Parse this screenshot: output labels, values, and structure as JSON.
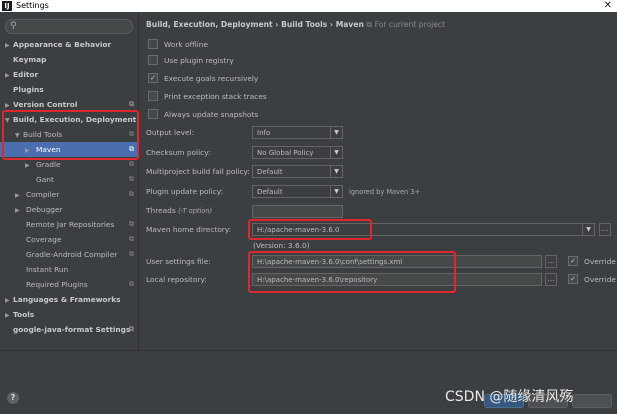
{
  "window": {
    "title": "Settings",
    "app_icon": "IJ",
    "close_glyph": "✕"
  },
  "sidebar": {
    "search_placeholder": "",
    "items": [
      {
        "label": "Appearance & Behavior",
        "bold": true,
        "arrow": "▶"
      },
      {
        "label": "Keymap",
        "bold": true,
        "arrow": ""
      },
      {
        "label": "Editor",
        "bold": true,
        "arrow": "▶"
      },
      {
        "label": "Plugins",
        "bold": true,
        "arrow": ""
      },
      {
        "label": "Version Control",
        "bold": true,
        "arrow": "▶"
      },
      {
        "label": "Build, Execution, Deployment",
        "bold": true,
        "arrow": "▼"
      },
      {
        "label": "Build Tools",
        "bold": false,
        "arrow": "▼"
      },
      {
        "label": "Maven",
        "bold": false,
        "arrow": "▶"
      },
      {
        "label": "Gradle",
        "bold": false,
        "arrow": "▶"
      },
      {
        "label": "Gant",
        "bold": false,
        "arrow": ""
      },
      {
        "label": "Compiler",
        "bold": false,
        "arrow": "▶"
      },
      {
        "label": "Debugger",
        "bold": false,
        "arrow": "▶"
      },
      {
        "label": "Remote Jar Repositories",
        "bold": false,
        "arrow": ""
      },
      {
        "label": "Coverage",
        "bold": false,
        "arrow": ""
      },
      {
        "label": "Gradle-Android Compiler",
        "bold": false,
        "arrow": ""
      },
      {
        "label": "Instant Run",
        "bold": false,
        "arrow": ""
      },
      {
        "label": "Required Plugins",
        "bold": false,
        "arrow": ""
      },
      {
        "label": "Languages & Frameworks",
        "bold": true,
        "arrow": "▶"
      },
      {
        "label": "Tools",
        "bold": true,
        "arrow": "▶"
      },
      {
        "label": "google-java-format Settings",
        "bold": true,
        "arrow": ""
      }
    ],
    "config_glyph": "⧉"
  },
  "breadcrumb": {
    "path": "Build, Execution, Deployment › Build Tools › Maven",
    "scope_icon": "⧉",
    "scope": "For current project"
  },
  "checkboxes": [
    {
      "label": "Work offline",
      "checked": false
    },
    {
      "label": "Use plugin registry",
      "checked": false
    },
    {
      "label": "Execute goals recursively",
      "checked": true
    },
    {
      "label": "Print exception stack traces",
      "checked": false
    },
    {
      "label": "Always update snapshots",
      "checked": false
    }
  ],
  "form": {
    "output_level": {
      "label": "Output level:",
      "value": "Info"
    },
    "checksum_policy": {
      "label": "Checksum policy:",
      "value": "No Global Policy"
    },
    "multiproject_fail_policy": {
      "label": "Multiproject build fail policy:",
      "value": "Default"
    },
    "plugin_update_policy": {
      "label": "Plugin update policy:",
      "value": "Default",
      "note": "ignored by Maven 3+"
    },
    "threads": {
      "label": "Threads",
      "hint": "(-T option)",
      "value": ""
    },
    "maven_home": {
      "label": "Maven home directory:",
      "value": "H:/apache-maven-3.6.0",
      "version": "(Version: 3.6.0)"
    },
    "user_settings": {
      "label": "User settings file:",
      "value": "H:\\apache-maven-3.6.0\\conf\\settings.xml",
      "override_label": "Override",
      "override_checked": true
    },
    "local_repository": {
      "label": "Local repository:",
      "value": "H:\\apache-maven-3.6.0\\repository",
      "override_label": "Override",
      "override_checked": true
    },
    "browse_glyph": "...",
    "dropdown_glyph": "▼"
  },
  "footer": {
    "help": "?",
    "watermark": "CSDN @随缘清风殇"
  }
}
